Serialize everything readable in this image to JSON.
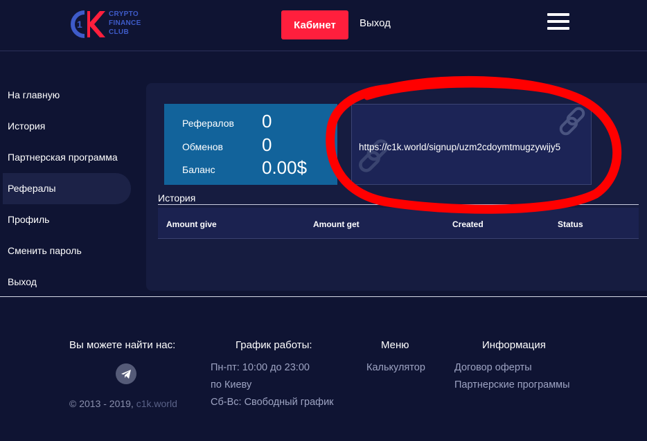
{
  "logo": {
    "lines": [
      "CRYPTO",
      "FINANCE",
      "CLUB"
    ],
    "mark": "1"
  },
  "header": {
    "cabinet_label": "Кабинет",
    "exit_label": "Выход"
  },
  "sidebar": {
    "items": [
      {
        "label": "На главную"
      },
      {
        "label": "История"
      },
      {
        "label": "Партнерская программа"
      },
      {
        "label": "Рефералы"
      },
      {
        "label": "Профиль"
      },
      {
        "label": "Сменить пароль"
      },
      {
        "label": "Выход"
      }
    ]
  },
  "stats": {
    "referrals_label": "Рефералов",
    "referrals_value": "0",
    "exchanges_label": "Обменов",
    "exchanges_value": "0",
    "balance_label": "Баланс",
    "balance_value": "0.00$"
  },
  "referral_link": "https://c1k.world/signup/uzm2cdoymtmugzywijy5",
  "history": {
    "title": "История",
    "columns": [
      "Amount give",
      "Amount get",
      "Created",
      "Status"
    ]
  },
  "footer": {
    "find_us": "Вы можете найти нас:",
    "schedule_title": "График работы:",
    "schedule_line1": "Пн-пт: 10:00 до 23:00",
    "schedule_line2": "по Киеву",
    "schedule_line3": "Сб-Вс: Свободный график",
    "menu_title": "Меню",
    "menu_item": "Калькулятор",
    "info_title": "Информация",
    "info_item1": "Договор оферты",
    "info_item2": "Партнерские программы",
    "copyright": "© 2013 - 2019,",
    "copyright_site": "c1k.world"
  },
  "colors": {
    "background": "#0f1433",
    "accent": "#ff1f3d",
    "stats_panel": "#12639b",
    "annotation": "#ff0000"
  }
}
